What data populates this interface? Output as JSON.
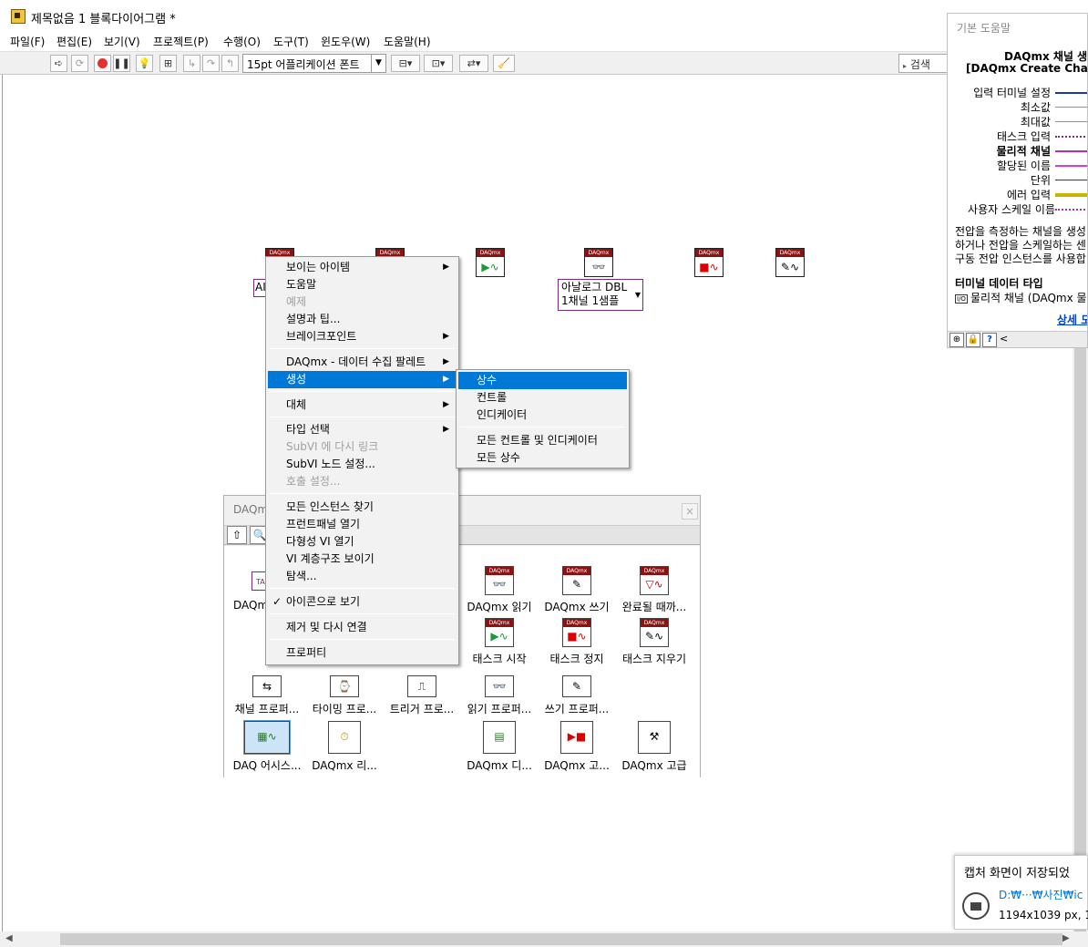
{
  "window": {
    "title": "제목없음 1 블록다이어그램 *"
  },
  "menubar": [
    "파일(F)",
    "편집(E)",
    "보기(V)",
    "프로젝트(P)",
    "수행(O)",
    "도구(T)",
    "윈도우(W)",
    "도움말(H)"
  ],
  "toolbar": {
    "font_select": "15pt 어플리케이션 폰트",
    "search": "검색"
  },
  "diagram": {
    "icon_header": "DAQmx",
    "ai_box": "AI",
    "poly_selector": [
      "아날로그 DBL",
      "1채널 1샘플"
    ]
  },
  "context_menu": {
    "items": [
      {
        "label": "보이는 아이템",
        "sub": true
      },
      {
        "label": "도움말"
      },
      {
        "label": "예제",
        "disabled": true
      },
      {
        "label": "설명과 팁..."
      },
      {
        "label": "브레이크포인트",
        "sub": true
      },
      {
        "label": "DAQmx - 데이터 수집 팔레트",
        "sub": true
      },
      {
        "label": "생성",
        "sub": true,
        "highlighted": true
      },
      {
        "label": "대체",
        "sub": true
      },
      {
        "label": "타입 선택",
        "sub": true
      },
      {
        "label": "SubVI 에 다시 링크",
        "disabled": true
      },
      {
        "label": "SubVI 노드 설정..."
      },
      {
        "label": "호출 설정...",
        "disabled": true
      },
      {
        "label": "모든 인스턴스 찾기"
      },
      {
        "label": "프런트패널 열기"
      },
      {
        "label": "다형성 VI 열기"
      },
      {
        "label": "VI 계층구조 보이기"
      },
      {
        "label": "탐색..."
      },
      {
        "label": "아이콘으로 보기",
        "checked": true
      },
      {
        "label": "제거 및 다시 연결"
      },
      {
        "label": "프로퍼티"
      }
    ]
  },
  "submenu": {
    "items": [
      "상수",
      "컨트롤",
      "인디케이터",
      "모든 컨트롤 및 인디케이터",
      "모든 상수"
    ]
  },
  "palette": {
    "title": "DAQmx",
    "items": [
      {
        "label": "DAQmx",
        "icon": "TASK"
      },
      {
        "label": "DAQmx 읽기",
        "icon": "read"
      },
      {
        "label": "DAQmx 쓰기",
        "icon": "write"
      },
      {
        "label": "완료될 때까...",
        "icon": "wait"
      },
      {
        "label": "태스크 시작",
        "icon": "start"
      },
      {
        "label": "태스크 정지",
        "icon": "stop"
      },
      {
        "label": "태스크 지우기",
        "icon": "clear"
      },
      {
        "label": "채널 프로퍼...",
        "icon": "channel-node"
      },
      {
        "label": "타이밍 프로...",
        "icon": "timing-node"
      },
      {
        "label": "트리거 프로...",
        "icon": "trigger-node"
      },
      {
        "label": "읽기 프로퍼...",
        "icon": "read-node"
      },
      {
        "label": "쓰기 프로퍼...",
        "icon": "write-node"
      },
      {
        "label": "DAQ 어시스...",
        "icon": "assistant"
      },
      {
        "label": "DAQmx 리...",
        "icon": "real-time"
      },
      {
        "label": "DAQmx 디...",
        "icon": "device"
      },
      {
        "label": "DAQmx 고...",
        "icon": "advanced-task"
      },
      {
        "label": "DAQmx 고급",
        "icon": "advanced"
      }
    ]
  },
  "help": {
    "title": "기본 도움말",
    "name_ko": "DAQmx 채널 생성",
    "name_en": "[DAQmx Create Channel]",
    "terminals": [
      "입력 터미널 설정",
      "최소값",
      "최대값",
      "태스크 입력",
      "물리적 채널",
      "할당된 이름",
      "단위",
      "에러 입력",
      "사용자 스케일 이름"
    ],
    "description": [
      "전압을 측정하는 채널을 생성",
      "하거나 전압을 스케일하는 센",
      "구동 전압 인스턴스를 사용합"
    ],
    "section": "터미널 데이터 타입",
    "dtype": "물리적 채널 (DAQmx 물",
    "dtype_badge": "I/O",
    "more_link": "상세 도"
  },
  "toast": {
    "title": "캡처 화면이 저장되었",
    "path": "D:₩···₩사진₩ic",
    "info": "1194x1039 px, 1("
  }
}
